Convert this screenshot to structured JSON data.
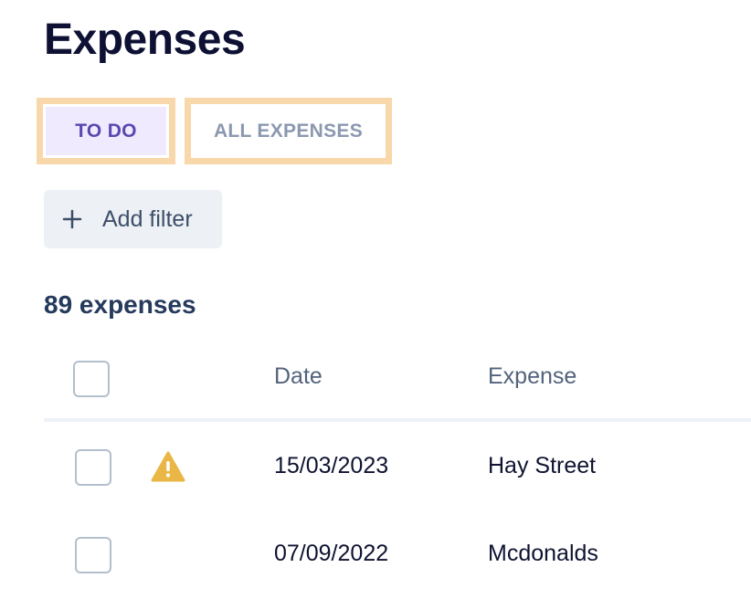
{
  "page": {
    "title": "Expenses"
  },
  "tabs": [
    {
      "label": "TO DO",
      "active": true
    },
    {
      "label": "ALL EXPENSES",
      "active": false
    }
  ],
  "filter": {
    "add_label": "Add filter",
    "icon": "plus-icon"
  },
  "summary": {
    "count_label": "89 expenses"
  },
  "table": {
    "columns": [
      "Date",
      "Expense"
    ],
    "rows": [
      {
        "date": "15/03/2023",
        "expense": "Hay Street",
        "warning": true,
        "warning_icon": "warning-icon"
      },
      {
        "date": "07/09/2022",
        "expense": "Mcdonalds",
        "warning": false
      }
    ]
  },
  "colors": {
    "active_tab_bg": "#efeafd",
    "active_tab_text": "#5b47b0",
    "inactive_tab_text": "#8a98b0",
    "highlight_border": "#f8d7aa",
    "warning": "#eab746"
  }
}
